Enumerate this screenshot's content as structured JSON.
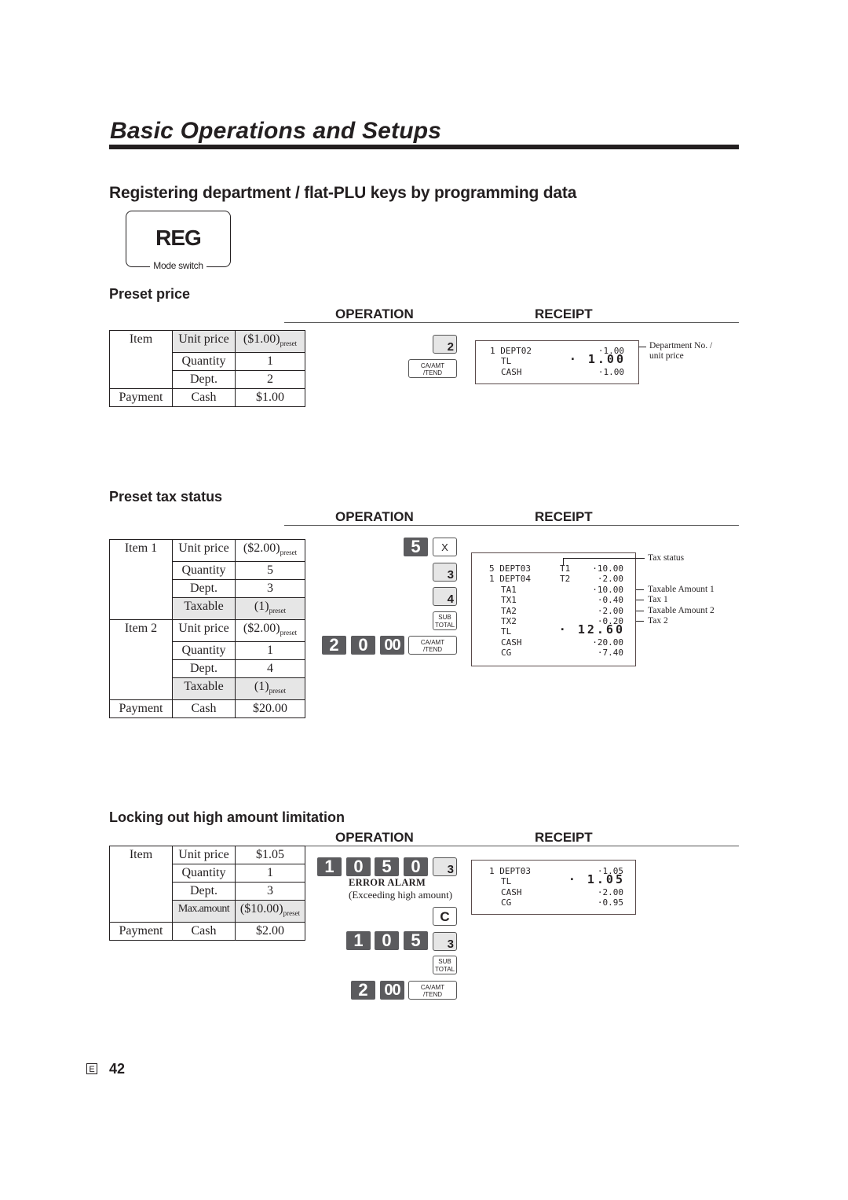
{
  "page": {
    "title": "Basic Operations and Setups",
    "section_heading": "Registering department / flat-PLU keys by programming data",
    "mode_switch": {
      "value": "REG",
      "label": "Mode switch"
    },
    "column_headers": {
      "operation": "OPERATION",
      "receipt": "RECEIPT"
    },
    "footer": {
      "language_code": "E",
      "page_number": "42"
    }
  },
  "preset_price": {
    "heading": "Preset price",
    "table": {
      "item_label": "Item",
      "rows": [
        {
          "field": "Unit price",
          "value": "($1.00)",
          "suffix": "preset"
        },
        {
          "field": "Quantity",
          "value": "1"
        },
        {
          "field": "Dept.",
          "value": "2"
        }
      ],
      "payment_label": "Payment",
      "payment_field": "Cash",
      "payment_value": "$1.00"
    },
    "operation_keys": [
      {
        "label": "2",
        "type": "dept"
      },
      {
        "label_top": "CA/AMT",
        "label_bottom": "/TEND",
        "type": "func"
      }
    ],
    "receipt": {
      "lines": [
        {
          "qty": "1",
          "name": "DEPT02",
          "amount": "·1.00"
        },
        {
          "name": "TL",
          "amount": "· 1.00",
          "big": true
        },
        {
          "name": "CASH",
          "amount": "·1.00"
        }
      ]
    },
    "annotations": [
      "Department No. /",
      "unit price"
    ]
  },
  "preset_tax": {
    "heading": "Preset tax status",
    "table": {
      "items": [
        {
          "label": "Item 1",
          "rows": [
            {
              "field": "Unit price",
              "value": "($2.00)",
              "suffix": "preset"
            },
            {
              "field": "Quantity",
              "value": "5"
            },
            {
              "field": "Dept.",
              "value": "3"
            },
            {
              "field": "Taxable",
              "value": "(1)",
              "suffix": "preset"
            }
          ]
        },
        {
          "label": "Item 2",
          "rows": [
            {
              "field": "Unit price",
              "value": "($2.00)",
              "suffix": "preset"
            },
            {
              "field": "Quantity",
              "value": "1"
            },
            {
              "field": "Dept.",
              "value": "4"
            },
            {
              "field": "Taxable",
              "value": "(1)",
              "suffix": "preset"
            }
          ]
        }
      ],
      "payment_label": "Payment",
      "payment_field": "Cash",
      "payment_value": "$20.00"
    },
    "operation_keys": {
      "qty_key": "5",
      "multiply_key": "X",
      "dept3": "3",
      "dept4": "4",
      "subtotal_top": "SUB",
      "subtotal_bottom": "TOTAL",
      "tender_digits": [
        "2",
        "0",
        "00"
      ],
      "tender_top": "CA/AMT",
      "tender_bottom": "/TEND"
    },
    "receipt": {
      "lines": [
        {
          "qty": "5",
          "name": "DEPT03",
          "tax": "T1",
          "amount": "·10.00"
        },
        {
          "qty": "1",
          "name": "DEPT04",
          "tax": "T2",
          "amount": "·2.00"
        },
        {
          "name": "TA1",
          "amount": "·10.00"
        },
        {
          "name": "TX1",
          "amount": "·0.40"
        },
        {
          "name": "TA2",
          "amount": "·2.00"
        },
        {
          "name": "TX2",
          "amount": "·0.20"
        },
        {
          "name": "TL",
          "amount": "· 12.60",
          "big": true
        },
        {
          "name": "CASH",
          "amount": "·20.00"
        },
        {
          "name": "CG",
          "amount": "·7.40"
        }
      ]
    },
    "annotations": {
      "tax_status": "Tax status",
      "taxable_amount_1": "Taxable Amount 1",
      "tax_1": "Tax 1",
      "taxable_amount_2": "Taxable Amount 2",
      "tax_2": "Tax 2"
    }
  },
  "high_amount": {
    "heading": "Locking out high amount limitation",
    "table": {
      "item_label": "Item",
      "rows": [
        {
          "field": "Unit price",
          "value": "$1.05"
        },
        {
          "field": "Quantity",
          "value": "1"
        },
        {
          "field": "Dept.",
          "value": "3"
        },
        {
          "field": "Max.amount",
          "value": "($10.00)",
          "suffix": "preset"
        }
      ],
      "payment_label": "Payment",
      "payment_field": "Cash",
      "payment_value": "$2.00"
    },
    "operation_keys": {
      "first_entry": [
        "1",
        "0",
        "5",
        "0"
      ],
      "first_dept": "3",
      "error_title": "ERROR ALARM",
      "error_detail": "(Exceeding high amount)",
      "clear_key": "C",
      "second_entry": [
        "1",
        "0",
        "5"
      ],
      "second_dept": "3",
      "subtotal_top": "SUB",
      "subtotal_bottom": "TOTAL",
      "tender_digits": [
        "2",
        "00"
      ],
      "tender_top": "CA/AMT",
      "tender_bottom": "/TEND"
    },
    "receipt": {
      "lines": [
        {
          "qty": "1",
          "name": "DEPT03",
          "amount": "·1.05"
        },
        {
          "name": "TL",
          "amount": "· 1.05",
          "big": true
        },
        {
          "name": "CASH",
          "amount": "·2.00"
        },
        {
          "name": "CG",
          "amount": "·0.95"
        }
      ]
    }
  }
}
